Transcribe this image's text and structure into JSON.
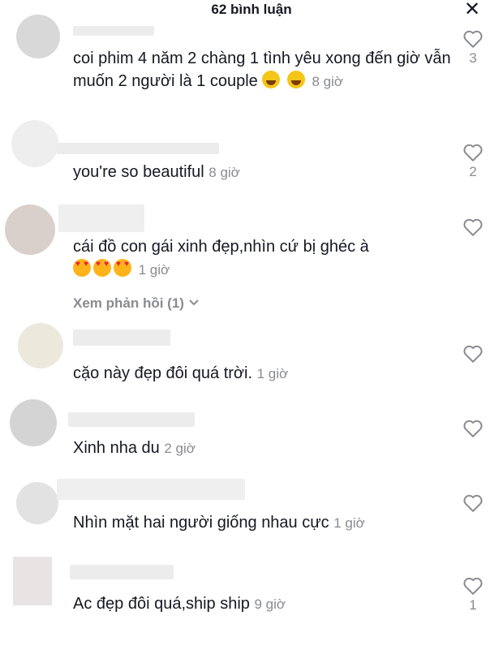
{
  "header": {
    "title": "62 bình luận",
    "close_label": "✕"
  },
  "comments": [
    {
      "text": "coi phim 4 năm 2 chàng 1 tình yêu xong đến giờ vẫn muốn 2 người là 1 couple",
      "time": "8 giờ",
      "likes": "3"
    },
    {
      "text": "you're so beautiful",
      "time": "8 giờ",
      "likes": "2"
    },
    {
      "text": "cái đồ con gái xinh đẹp,nhìn cứ bị ghéc à",
      "time": "1 giờ",
      "likes": "",
      "replies": "Xem phản hồi (1)"
    },
    {
      "text": "cặo này đẹp đôi quá trời.",
      "time": "1 giờ",
      "likes": ""
    },
    {
      "text": "Xinh nha du",
      "time": "2 giờ",
      "likes": ""
    },
    {
      "text": "Nhìn mặt hai người giống nhau cực",
      "time": "1 giờ",
      "likes": ""
    },
    {
      "text": "Ac đẹp đôi quá,ship ship",
      "time": "9 giờ",
      "likes": "1"
    }
  ],
  "icons": {
    "like": "heart-outline-icon",
    "close": "close-icon",
    "chevron": "chevron-down-icon"
  },
  "colors": {
    "text": "#161823",
    "secondary": "#8a8b91"
  }
}
